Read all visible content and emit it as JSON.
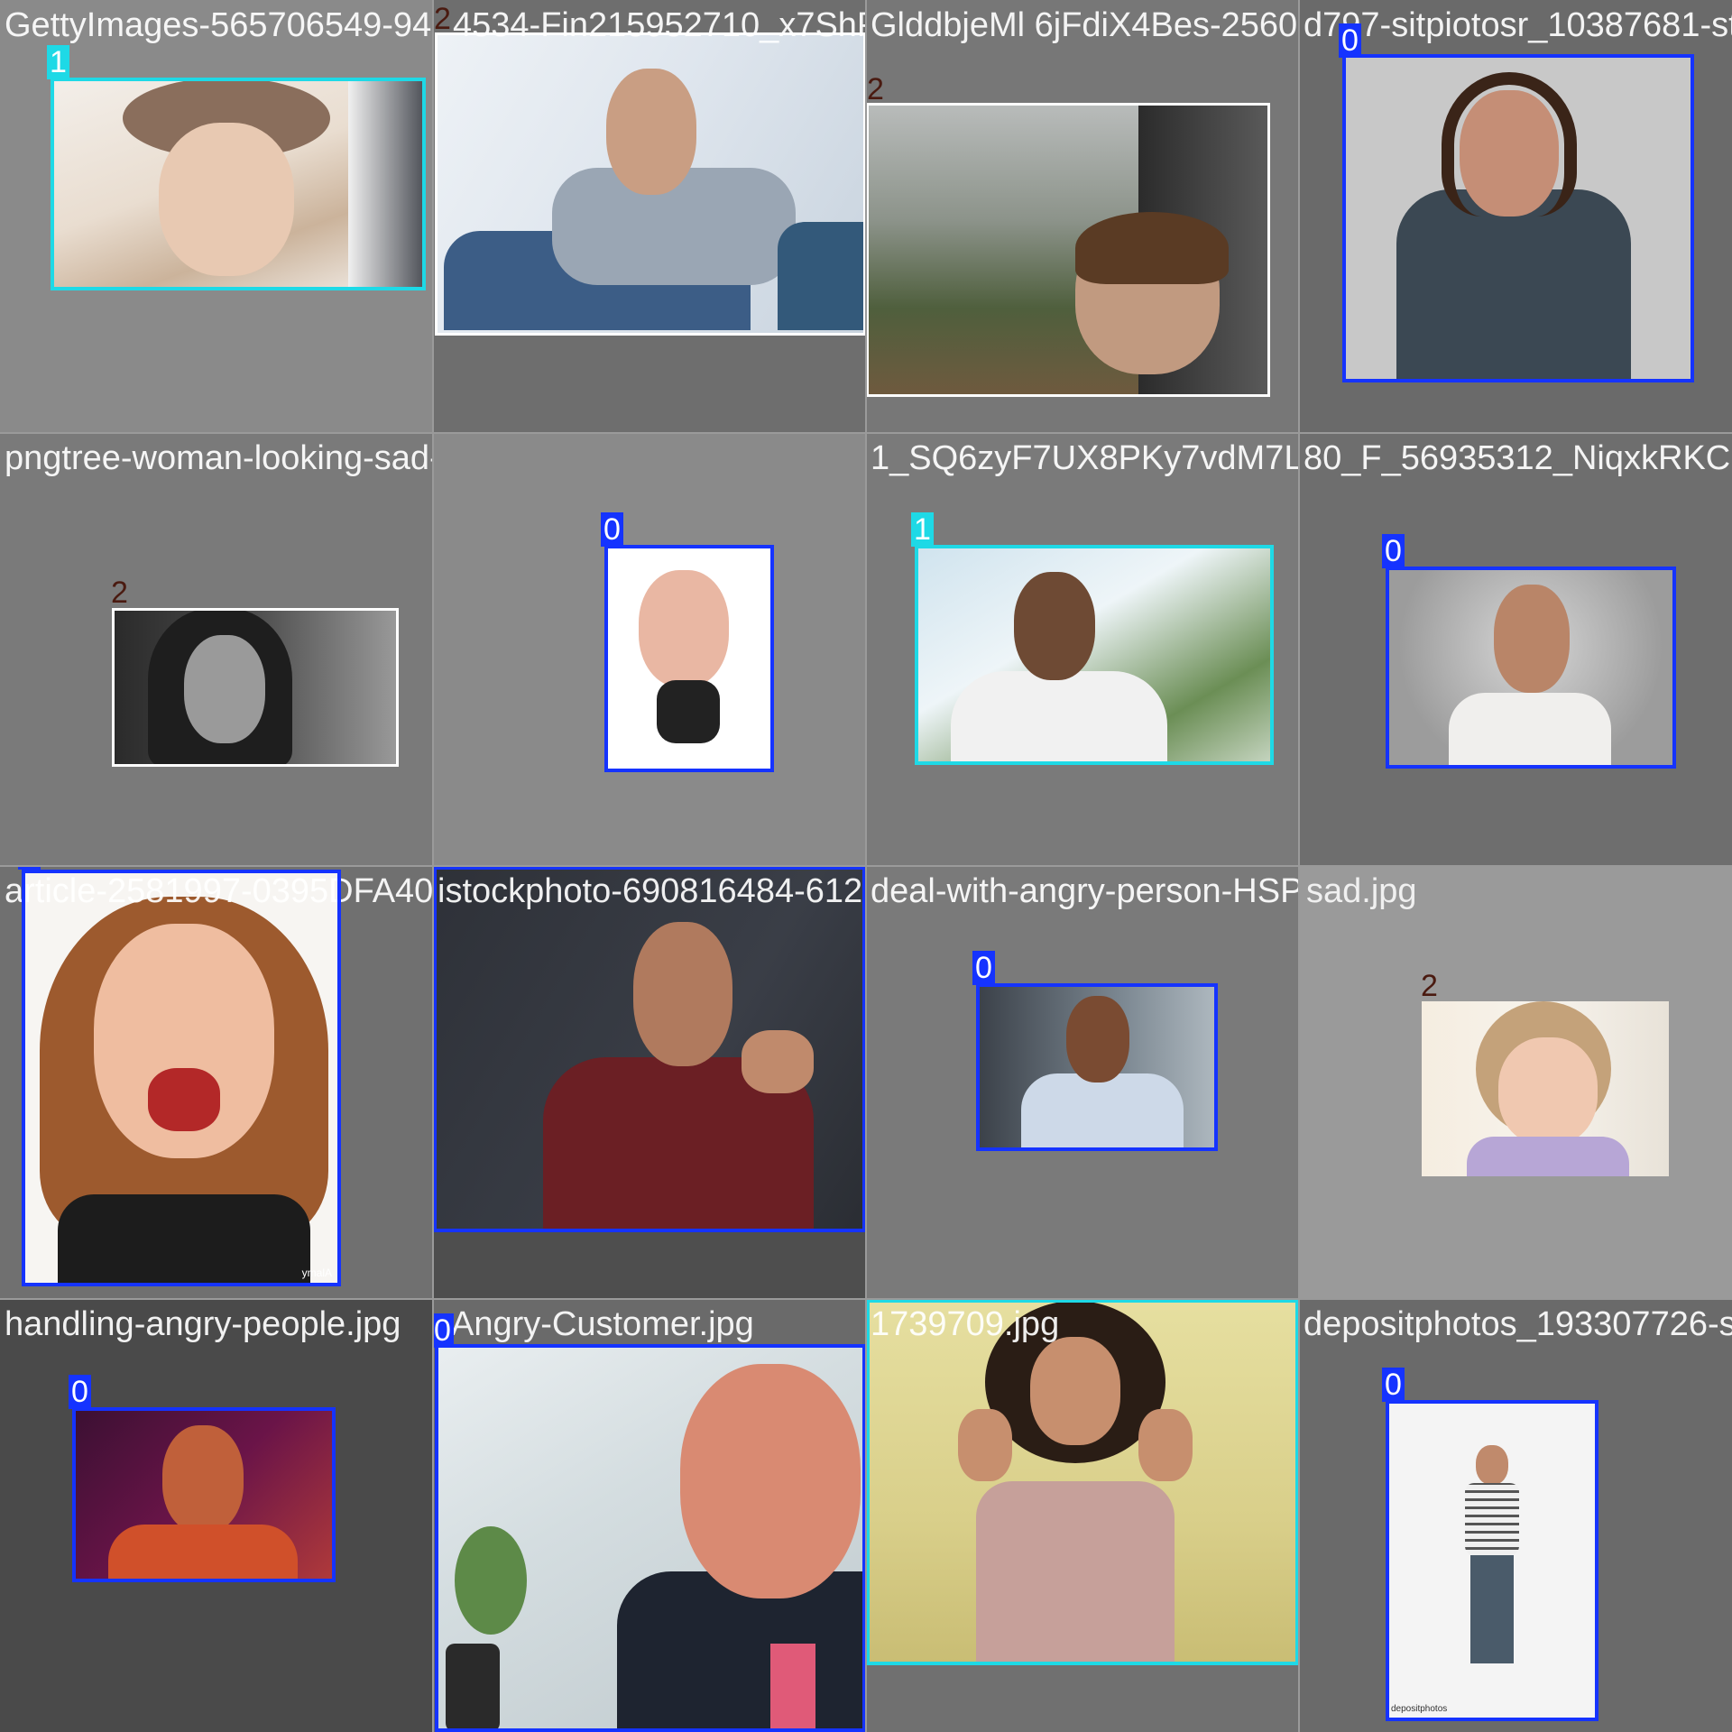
{
  "colors": {
    "class_0": "#1533ff",
    "class_1": "#1ed9e6",
    "class_2": "#ffffff",
    "class_2_label": "#4a1a10",
    "mosaic_background": "#808080"
  },
  "tiles": [
    {
      "filename": "GettyImages-565706549-94...",
      "filename_extra": "2",
      "boxes": [
        {
          "label": "1"
        }
      ]
    },
    {
      "filename": "4534-Fin215952710_x7ShPli...",
      "filename_extra": "",
      "boxes": [
        {
          "label": "2"
        }
      ]
    },
    {
      "filename": "GlddbjeMl 6jFdiX4Bes-2560-x-...",
      "filename_extra": "",
      "boxes": [
        {
          "label": "2"
        }
      ]
    },
    {
      "filename": "d797-sitpiotosr_10387681-sto",
      "filename_extra": "",
      "boxes": [
        {
          "label": "0"
        }
      ]
    },
    {
      "filename": "pngtree-woman-looking-sad-anglyplasndnjpg",
      "filename_extra": "",
      "boxes": [
        {
          "label": "2"
        }
      ]
    },
    {
      "filename": "",
      "filename_extra": "",
      "boxes": [
        {
          "label": "0"
        }
      ]
    },
    {
      "filename": "1_SQ6zyF7UX8PKy7vdM7Ls6A.jpg",
      "filename_extra": "",
      "boxes": [
        {
          "label": "1"
        }
      ]
    },
    {
      "filename": "80_F_56935312_NiqxkRKC",
      "filename_extra": "",
      "boxes": [
        {
          "label": "0"
        }
      ]
    },
    {
      "filename": "article-2581997-0395DFA400000578-",
      "filename_extra": "",
      "boxes": [
        {
          "label": "0"
        }
      ]
    },
    {
      "filename": "istockphoto-690816484-612x612.jpg",
      "filename_extra": "",
      "boxes": [
        {
          "label": "0"
        }
      ]
    },
    {
      "filename": "deal-with-angry-person-HSP.jpg",
      "filename_extra": "",
      "boxes": [
        {
          "label": "0"
        }
      ]
    },
    {
      "filename": "sad.jpg",
      "filename_extra": "",
      "boxes": [
        {
          "label": "2"
        }
      ]
    },
    {
      "filename": "handling-angry-people.jpg",
      "filename_extra": "",
      "boxes": [
        {
          "label": "0"
        }
      ]
    },
    {
      "filename": "Angry-Customer.jpg",
      "filename_extra": "",
      "boxes": [
        {
          "label": "0"
        }
      ]
    },
    {
      "filename": "1739709.jpg",
      "filename_extra": "",
      "boxes": [
        {
          "label": "1"
        }
      ]
    },
    {
      "filename": "depositphotos_193307726-s",
      "filename_extra": "",
      "boxes": [
        {
          "label": "0"
        }
      ]
    }
  ],
  "watermarks": {
    "alamy": "ymalA",
    "depositphotos": "depositphotos"
  }
}
